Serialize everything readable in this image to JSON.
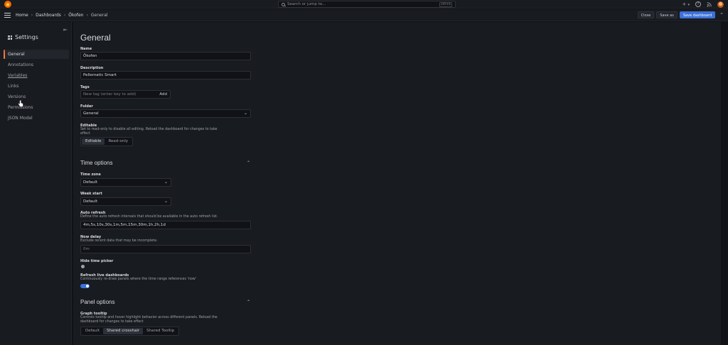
{
  "topbar": {
    "search_placeholder": "Search or jump to...",
    "search_shortcut": "ctrl+k",
    "plus_icon": "+",
    "plus_caret": "▾",
    "help_icon": "?",
    "news_icon": "rss"
  },
  "nav": {
    "breadcrumbs": [
      "Home",
      "Dashboards",
      "Ökofen",
      "General"
    ],
    "separator": "›",
    "close_label": "Close",
    "save_as_label": "Save as",
    "save_dashboard_label": "Save dashboard",
    "accent": "#3d71d9"
  },
  "sidebar": {
    "title": "Settings",
    "items": [
      {
        "label": "General",
        "active": true
      },
      {
        "label": "Annotations"
      },
      {
        "label": "Variables"
      },
      {
        "label": "Links"
      },
      {
        "label": "Versions"
      },
      {
        "label": "Permissions"
      },
      {
        "label": "JSON Model"
      }
    ]
  },
  "main": {
    "title": "General",
    "name_label": "Name",
    "name_value": "Ökofen",
    "description_label": "Description",
    "description_value": "Pellematic Smart",
    "tags_label": "Tags",
    "tags_placeholder": "New tag (enter key to add)",
    "tags_add": "Add",
    "folder_label": "Folder",
    "folder_value": "General",
    "editable_label": "Editable",
    "editable_desc": "Set to read-only to disable all editing. Reload the dashboard for changes to take effect",
    "editable_options": [
      "Editable",
      "Read-only"
    ],
    "time_options_title": "Time options",
    "timezone_label": "Time zone",
    "timezone_value": "Default",
    "weekstart_label": "Week start",
    "weekstart_value": "Default",
    "autorefresh_label": "Auto refresh",
    "autorefresh_desc": "Define the auto refresh intervals that should be available in the auto refresh list.",
    "autorefresh_value": "4m,5s,10s,30s,1m,5m,15m,30m,1h,2h,1d",
    "nowdelay_label": "Now delay",
    "nowdelay_desc": "Exclude recent data that may be incomplete.",
    "nowdelay_placeholder": "0m",
    "hidepicker_label": "Hide time picker",
    "refreshlive_label": "Refresh live dashboards",
    "refreshlive_desc": "Continuously re-draw panels where the time range references 'now'",
    "panel_options_title": "Panel options",
    "tooltip_label": "Graph tooltip",
    "tooltip_desc": "Controls tooltip and hover highlight behavior across different panels. Reload the dashboard for changes to take effect",
    "tooltip_options": [
      "Default",
      "Shared crosshair",
      "Shared Tooltip"
    ]
  }
}
